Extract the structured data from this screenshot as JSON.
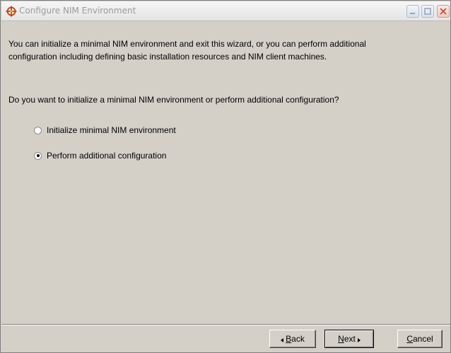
{
  "window": {
    "title": "Configure NIM Environment",
    "icons": {
      "app": "nim-app-icon",
      "minimize": "minimize-icon",
      "maximize": "maximize-icon",
      "close": "close-icon"
    }
  },
  "content": {
    "intro_text": "You can initialize a minimal NIM environment and exit this wizard, or you can perform additional configuration including defining basic installation resources and NIM client machines.",
    "question": "Do you want to initialize a minimal NIM environment or perform  additional configuration?",
    "options": [
      {
        "label": "Initialize minimal NIM environment",
        "selected": false
      },
      {
        "label": "Perform additional configuration",
        "selected": true
      }
    ]
  },
  "footer": {
    "back": {
      "mnemonic": "B",
      "rest": "ack"
    },
    "next": {
      "mnemonic": "N",
      "rest": "ext"
    },
    "cancel": {
      "mnemonic": "C",
      "rest": "ancel"
    }
  },
  "colors": {
    "panel": "#d4d0c8",
    "title_text": "#9a9a9a",
    "icon_accent": "#c8501e"
  }
}
